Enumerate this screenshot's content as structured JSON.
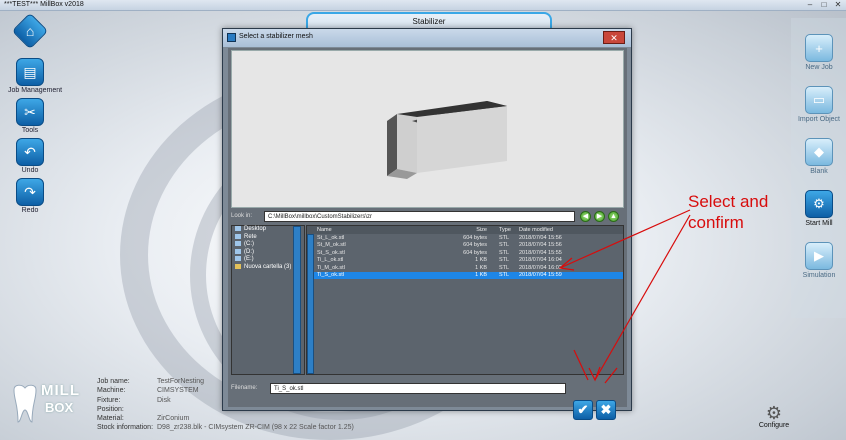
{
  "window": {
    "title": "***TEST*** MillBox v2018",
    "min": "–",
    "max": "□",
    "close": "✕"
  },
  "left_toolbar": [
    {
      "label": ""
    },
    {
      "label": "Job Management"
    },
    {
      "label": "Tools"
    },
    {
      "label": "Undo"
    },
    {
      "label": "Redo"
    }
  ],
  "right_toolbar": [
    {
      "label": "New Job"
    },
    {
      "label": "Import Object"
    },
    {
      "label": "Blank"
    },
    {
      "label": "Start Mill"
    },
    {
      "label": "Simulation"
    }
  ],
  "stabilizer_panel": {
    "title": "Stabilizer"
  },
  "dialog": {
    "title": "Select a stabilizer mesh",
    "look_in_label": "Look in:",
    "path": "C:\\MillBox\\millbox\\CustomStabilizers\\zr",
    "nav_back": "◀",
    "nav_forward": "▶",
    "nav_up": "▲",
    "tree": [
      "Desktop",
      "Rete",
      "(C:)",
      "(D:)",
      "(E:)",
      "Nuova cartella (3)"
    ],
    "columns": {
      "name": "Name",
      "size": "Size",
      "type": "Type",
      "date": "Date modified"
    },
    "files": [
      {
        "name": "St_L_ok.stl",
        "size": "604 bytes",
        "type": "STL",
        "date": "2018/07/04 15:56"
      },
      {
        "name": "St_M_ok.stl",
        "size": "604 bytes",
        "type": "STL",
        "date": "2018/07/04 15:56"
      },
      {
        "name": "St_S_ok.stl",
        "size": "604 bytes",
        "type": "STL",
        "date": "2018/07/04 15:55"
      },
      {
        "name": "Ti_L_ok.stl",
        "size": "1 KB",
        "type": "STL",
        "date": "2018/07/04 16:04"
      },
      {
        "name": "Ti_M_ok.stl",
        "size": "1 KB",
        "type": "STL",
        "date": "2018/07/04 16:02"
      },
      {
        "name": "Ti_S_ok.stl",
        "size": "1 KB",
        "type": "STL",
        "date": "2018/07/04 15:59"
      }
    ],
    "selected_index": 5,
    "filename_label": "Filename:",
    "filename_value": "Ti_S_ok.stl",
    "ok_glyph": "✔",
    "cancel_glyph": "✖"
  },
  "annotation": {
    "line1": "Select and",
    "line2": "confirm"
  },
  "info": [
    {
      "key": "Job name:",
      "value": "TestForNesting"
    },
    {
      "key": "Machine:",
      "value": "CIMSYSTEM"
    },
    {
      "key": "Fixture:",
      "value": "Disk"
    },
    {
      "key": "Position:",
      "value": ""
    },
    {
      "key": "Material:",
      "value": "ZirConium"
    },
    {
      "key": "Stock information:",
      "value": "D98_zr238.blk - CIMsystem ZR-CIM (98 x 22 Scale factor 1.25)"
    }
  ],
  "logo": {
    "line1": "MILL",
    "line2": "BOX"
  },
  "configure": {
    "label": "Configure"
  },
  "colors": {
    "accent": "#0d5fa6",
    "selection": "#1e86e6",
    "annotation": "#d80c0c"
  }
}
